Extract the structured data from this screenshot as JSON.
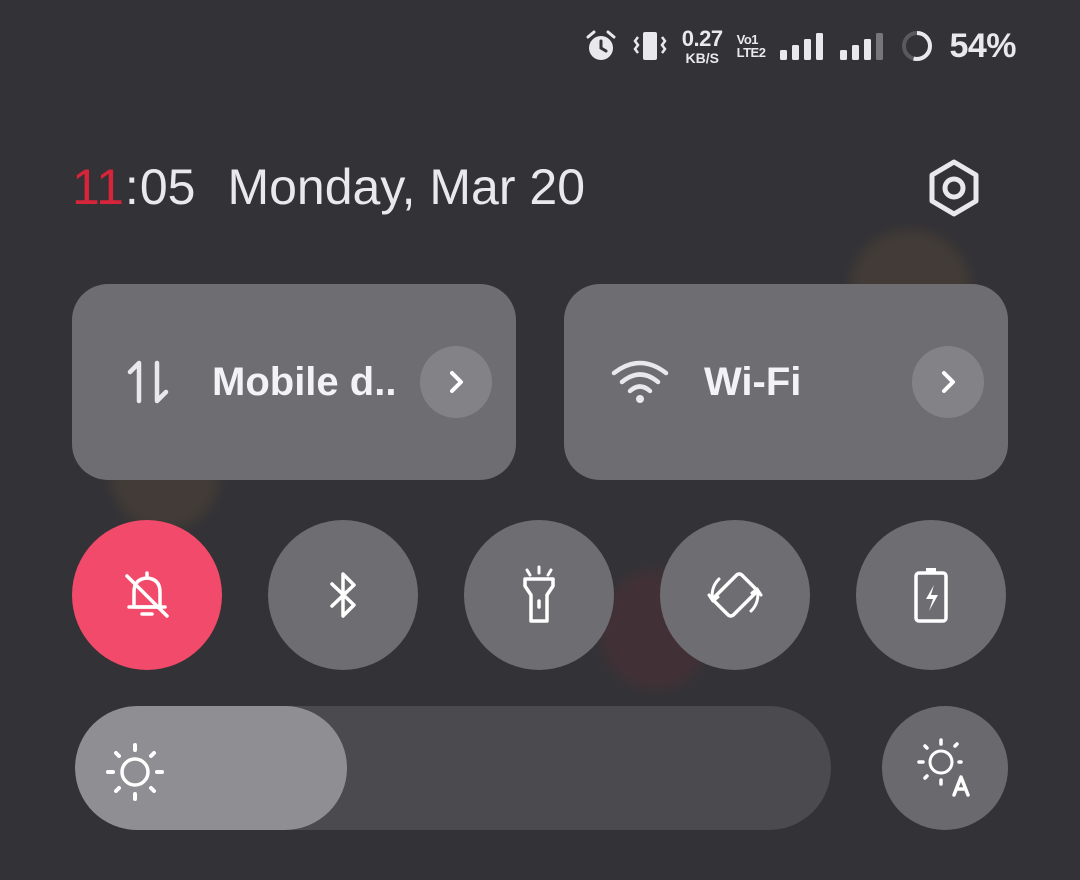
{
  "status_bar": {
    "net_speed_value": "0.27",
    "net_speed_unit": "KB/S",
    "volte_top": "Vo",
    "volte_sim_top": "1",
    "volte_bottom": "LTE",
    "volte_sim_bottom": "2",
    "battery_percent": "54%",
    "battery_level": 0.54,
    "icons": [
      "alarm-icon",
      "vibrate-icon",
      "signal-sim1-icon",
      "signal-sim2-icon",
      "battery-ring-icon"
    ]
  },
  "header": {
    "clock_hours": "11",
    "clock_separator": ":",
    "clock_minutes": "05",
    "date": "Monday, Mar 20",
    "settings_icon": "gear-icon"
  },
  "tiles": [
    {
      "label": "Mobile d..",
      "icon": "mobile-data-icon",
      "arrow_icon": "chevron-right-icon"
    },
    {
      "label": "Wi-Fi",
      "icon": "wifi-icon",
      "arrow_icon": "chevron-right-icon"
    }
  ],
  "toggles": [
    {
      "name": "silent-mode",
      "icon": "bell-off-icon",
      "active": true
    },
    {
      "name": "bluetooth",
      "icon": "bluetooth-icon",
      "active": false
    },
    {
      "name": "flashlight",
      "icon": "flashlight-icon",
      "active": false
    },
    {
      "name": "auto-rotate",
      "icon": "rotate-icon",
      "active": false
    },
    {
      "name": "battery-saver",
      "icon": "battery-charging-icon",
      "active": false
    }
  ],
  "brightness": {
    "level": 0.36,
    "icon": "sun-icon",
    "auto_icon": "auto-brightness-icon"
  },
  "colors": {
    "background": "#333236",
    "tile": "#6e6d72",
    "active_toggle": "#f24a6a",
    "clock_hour": "#d6243a"
  }
}
